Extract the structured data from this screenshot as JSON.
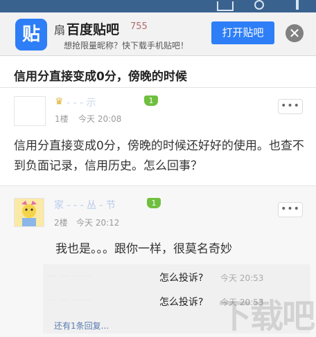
{
  "banner": {
    "logo_text": "贴",
    "title": "百度贴吧",
    "faint_text": "扇",
    "faint_number": "755",
    "subtitle": "想抢限量昵称？快下载手机贴吧！",
    "open_label": "打开贴吧",
    "close_symbol": "✕"
  },
  "post": {
    "title": "信用分直接变成0分，傍晚的时候"
  },
  "floor1": {
    "crown_icon": "♛",
    "username": "- - - 示",
    "level": "1",
    "floor": "1楼",
    "time": "今天 20:08",
    "more": "•••",
    "content": "信用分直接变成0分，傍晚的时候还好好的使用。也查不到负面记录，信用历史。怎么回事？"
  },
  "floor2": {
    "username": "家 - - - 丛 - 节",
    "level": "1",
    "floor": "2楼",
    "time": "今天 20:12",
    "more": "•••",
    "content": "我也是。。。跟你一样，很莫名奇妙"
  },
  "replies": [
    {
      "user": "— — ——",
      "text": "怎么投诉?",
      "time": "今天 20:53"
    },
    {
      "user": "— — ——",
      "text": "怎么投诉?",
      "time": "今天 20:53"
    }
  ],
  "more_replies": "还有1条回复...",
  "watermark": "下载吧"
}
